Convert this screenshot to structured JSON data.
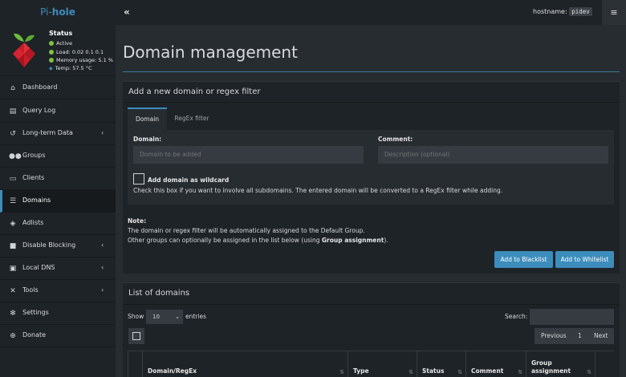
{
  "header": {
    "brand_prefix": "Pi-",
    "brand_name": "hole",
    "collapse_glyph": "«",
    "hostname_label": "hostname:",
    "hostname_value": "pidev",
    "menu_glyph": "≡"
  },
  "status": {
    "title": "Status",
    "active": "Active",
    "load": "Load:  0.02  0.1  0.1",
    "memory": "Memory usage:  5.1 %",
    "temp": "Temp: 57.5 °C",
    "status_color": "#7fc241"
  },
  "sidebar": {
    "items": [
      {
        "label": "Dashboard",
        "icon": "home-icon"
      },
      {
        "label": "Query Log",
        "icon": "file-icon"
      },
      {
        "label": "Long-term Data",
        "icon": "history-icon"
      },
      {
        "label": "Groups",
        "icon": "users-icon"
      },
      {
        "label": "Clients",
        "icon": "laptop-icon"
      },
      {
        "label": "Domains",
        "icon": "list-icon"
      },
      {
        "label": "Adlists",
        "icon": "shield-icon"
      },
      {
        "label": "Disable Blocking",
        "icon": "stop-icon"
      },
      {
        "label": "Local DNS",
        "icon": "address-book-icon"
      },
      {
        "label": "Tools",
        "icon": "wrench-icon"
      },
      {
        "label": "Settings",
        "icon": "gear-icon"
      },
      {
        "label": "Donate",
        "icon": "donate-icon"
      }
    ]
  },
  "main": {
    "page_title": "Domain management",
    "add_box": {
      "title": "Add a new domain or regex filter",
      "tabs": [
        {
          "label": "Domain"
        },
        {
          "label": "RegEx filter"
        }
      ],
      "domain_label": "Domain:",
      "domain_placeholder": "Domain to be added",
      "comment_label": "Comment:",
      "comment_placeholder": "Description (optional)",
      "wildcard_label": "Add domain as wildcard",
      "wildcard_help": "Check this box if you want to involve all subdomains. The entered domain will be converted to a RegEx filter while adding.",
      "note_title": "Note:",
      "note_line1": "The domain or regex filter will be automatically assigned to the Default Group.",
      "note_line2_prefix": "Other groups can optionally be assigned in the list below (using ",
      "note_line2_bold": "Group assignment",
      "note_line2_suffix": ").",
      "blacklist_button": "Add to Blacklist",
      "whitelist_button": "Add to Whitelist"
    },
    "list_box": {
      "title": "List of domains",
      "show_label": "Show",
      "entries_value": "10",
      "entries_label": "entries",
      "search_label": "Search:",
      "pager": {
        "previous": "Previous",
        "page": "1",
        "next": "Next"
      },
      "columns": [
        {
          "label": "Domain/RegEx"
        },
        {
          "label": "Type"
        },
        {
          "label": "Status"
        },
        {
          "label": "Comment"
        },
        {
          "label": "Group assignment"
        }
      ]
    }
  },
  "colors": {
    "accent": "#3c8dbc",
    "sidebar_bg": "#1e2327",
    "content_bg": "#272c30"
  }
}
